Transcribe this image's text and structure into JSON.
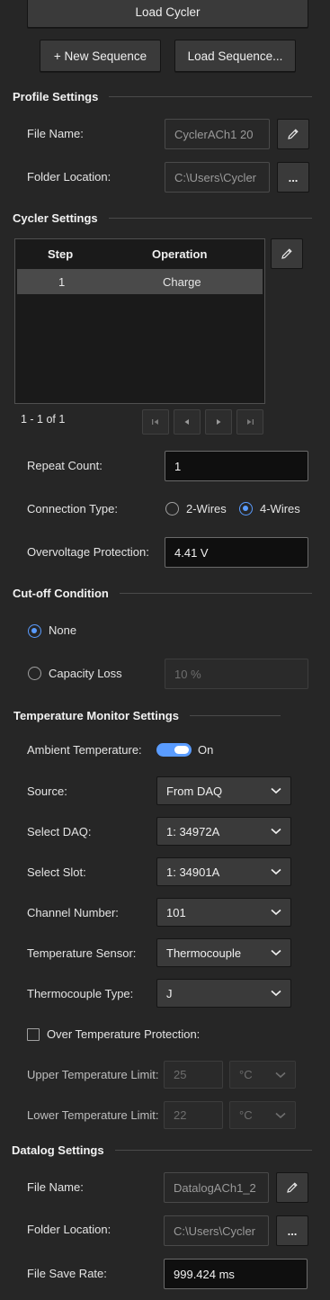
{
  "top_button": "Load Cycler",
  "sequence_buttons": {
    "new": "+ New Sequence",
    "load": "Load Sequence..."
  },
  "profile": {
    "title": "Profile Settings",
    "file_name_label": "File Name:",
    "file_name_value": "CyclerACh1 20",
    "folder_label": "Folder Location:",
    "folder_value": "C:\\Users\\Cycler",
    "browse_label": "..."
  },
  "cycler": {
    "title": "Cycler Settings",
    "columns": [
      "Step",
      "Operation"
    ],
    "rows": [
      {
        "step": "1",
        "operation": "Charge"
      }
    ],
    "pagination": "1 - 1 of 1",
    "repeat_label": "Repeat Count:",
    "repeat_value": "1",
    "connection_label": "Connection Type:",
    "connection_options": [
      "2-Wires",
      "4-Wires"
    ],
    "connection_selected": "4-Wires",
    "ovp_label": "Overvoltage Protection:",
    "ovp_value": "4.41 V"
  },
  "cutoff": {
    "title": "Cut-off Condition",
    "none_label": "None",
    "capacity_label": "Capacity Loss",
    "capacity_value": "10 %",
    "selected": "None"
  },
  "temperature": {
    "title": "Temperature Monitor Settings",
    "ambient_label": "Ambient Temperature:",
    "ambient_state": "On",
    "source_label": "Source:",
    "source_value": "From DAQ",
    "daq_label": "Select DAQ:",
    "daq_value": "1: 34972A",
    "slot_label": "Select Slot:",
    "slot_value": "1: 34901A",
    "channel_label": "Channel Number:",
    "channel_value": "101",
    "sensor_label": "Temperature Sensor:",
    "sensor_value": "Thermocouple",
    "tc_label": "Thermocouple Type:",
    "tc_value": "J",
    "otp_label": "Over Temperature Protection:",
    "upper_label": "Upper Temperature Limit:",
    "upper_value": "25",
    "upper_unit": "°C",
    "lower_label": "Lower Temperature Limit:",
    "lower_value": "22",
    "lower_unit": "°C"
  },
  "datalog": {
    "title": "Datalog Settings",
    "file_name_label": "File Name:",
    "file_name_value": "DatalogACh1_2",
    "folder_label": "Folder Location:",
    "folder_value": "C:\\Users\\Cycler",
    "browse_label": "...",
    "rate_label": "File Save Rate:",
    "rate_value": "999.424 ms"
  },
  "colors": {
    "accent": "#5a9cff",
    "background": "#262626",
    "button": "#3a3a3a"
  }
}
